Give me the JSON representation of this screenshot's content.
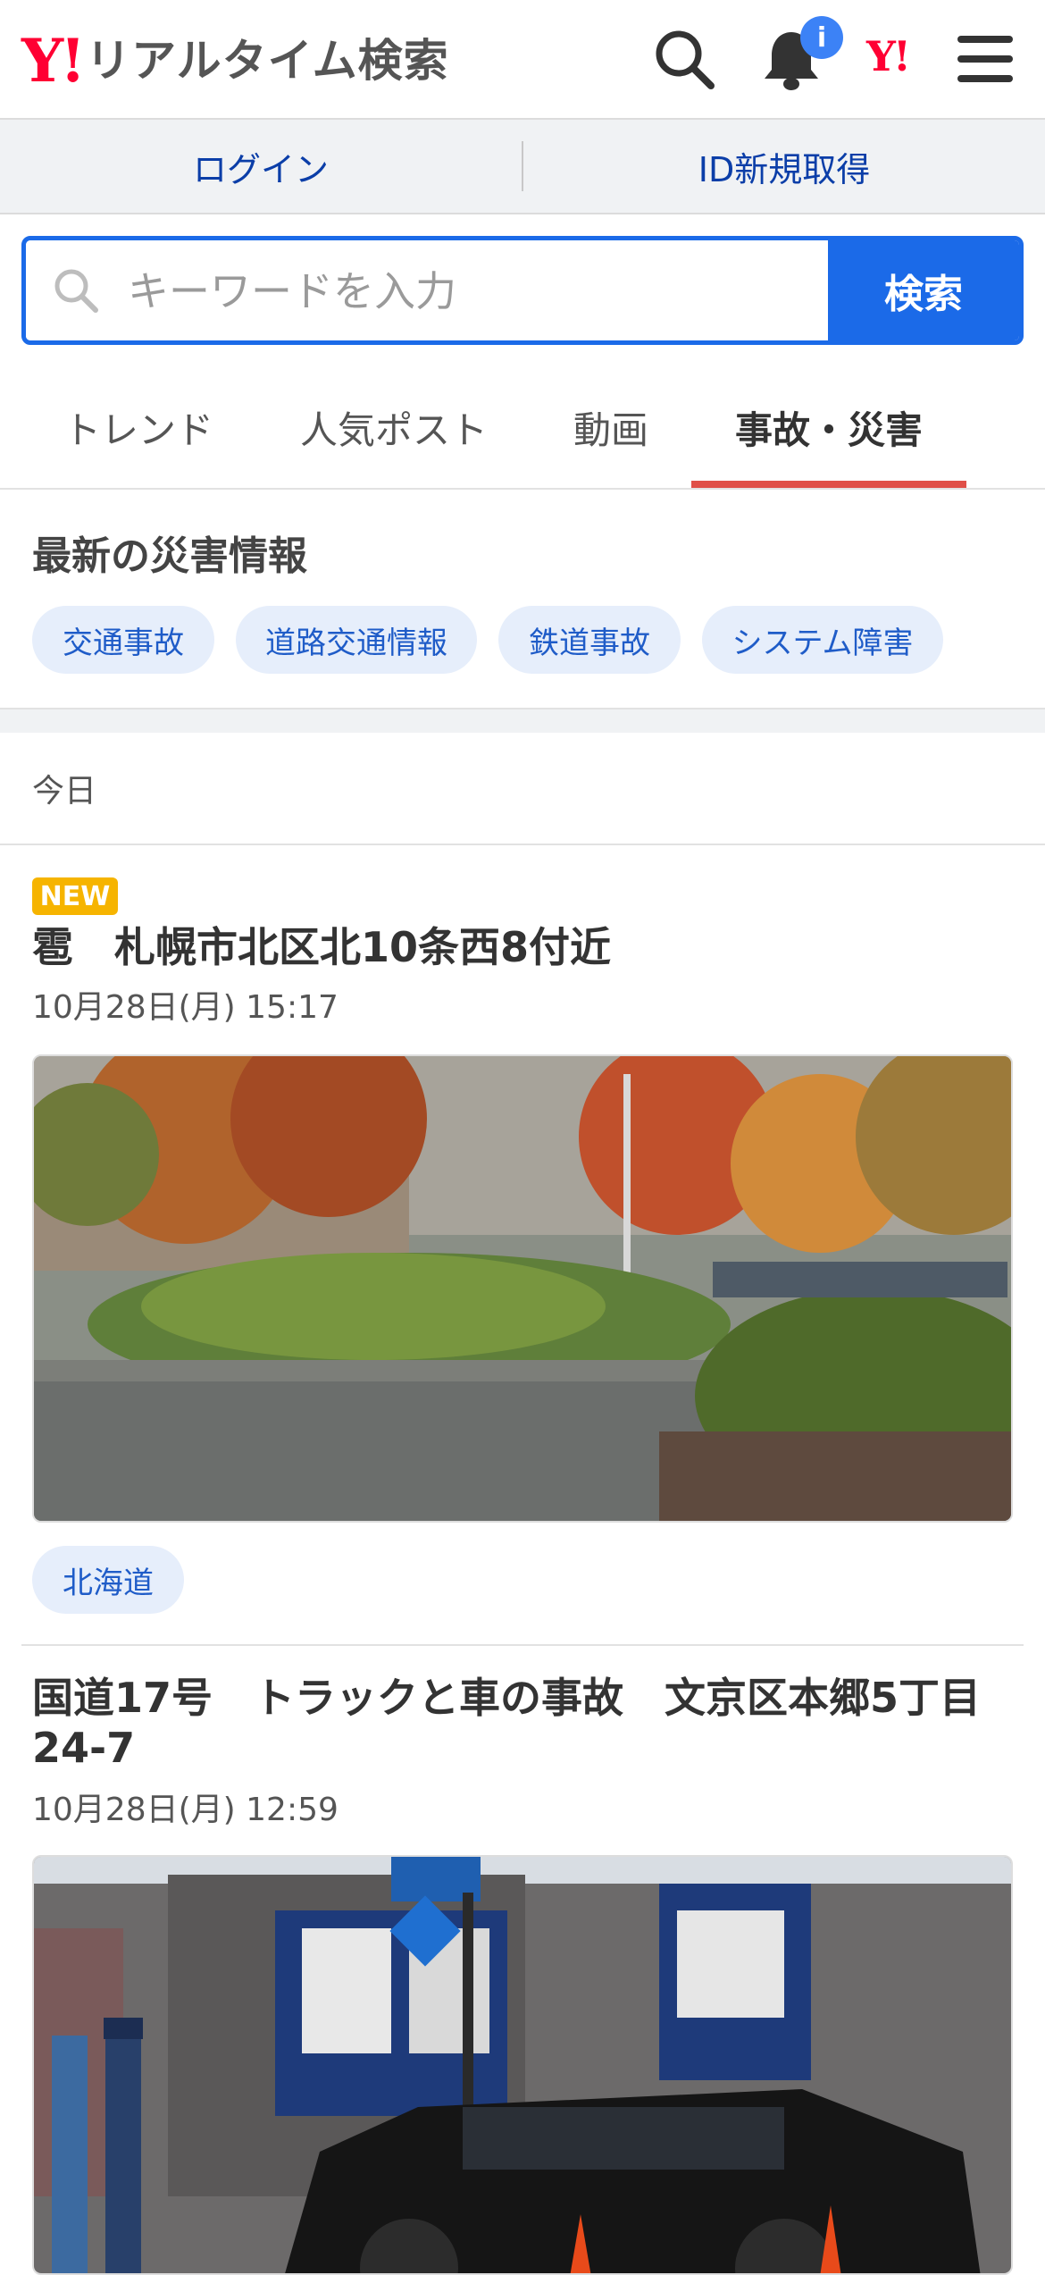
{
  "header": {
    "logo_mark": "Y!",
    "logo_text": "リアルタイム検索",
    "notification_badge": "i",
    "yahoo_mini": "Y!"
  },
  "auth": {
    "login": "ログイン",
    "register": "ID新規取得"
  },
  "search": {
    "placeholder": "キーワードを入力",
    "button": "検索"
  },
  "tabs": [
    {
      "label": "トレンド"
    },
    {
      "label": "人気ポスト"
    },
    {
      "label": "動画"
    },
    {
      "label": "事故・災害",
      "active": true
    }
  ],
  "section": {
    "title": "最新の災害情報",
    "chips": [
      "交通事故",
      "道路交通情報",
      "鉄道事故",
      "システム障害"
    ]
  },
  "date_heading": "今日",
  "posts": [
    {
      "badge": "NEW",
      "title": "雹　札幌市北区北10条西8付近",
      "time": "10月28日(月) 15:17",
      "tag": "北海道"
    },
    {
      "title": "国道17号　トラックと車の事故　文京区本郷5丁目24-7",
      "time": "10月28日(月) 12:59"
    }
  ],
  "colors": {
    "brand_red": "#ff0033",
    "accent_blue": "#1b6ae8",
    "active_tab_underline": "#e05048",
    "new_badge": "#f6b400"
  }
}
